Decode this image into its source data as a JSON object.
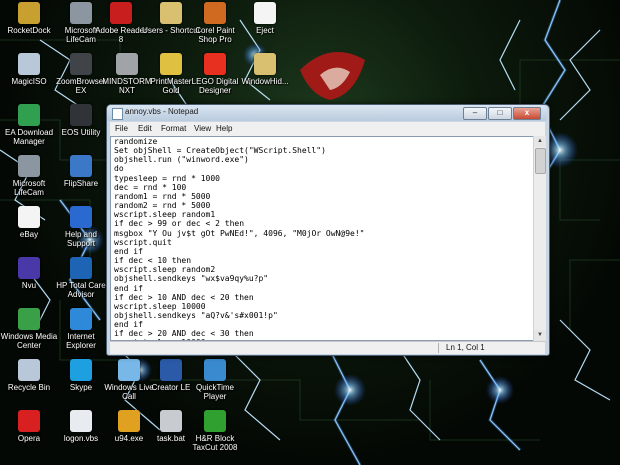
{
  "desktop": {
    "icons": [
      {
        "label": "RocketDock",
        "icon": "rocketdock-icon",
        "color": "#c8a030"
      },
      {
        "label": "Microsoft LifeCam",
        "icon": "webcam-icon",
        "color": "#8c96a0"
      },
      {
        "label": "Adobe Reader 8",
        "icon": "adobe-reader-icon",
        "color": "#c81e1e"
      },
      {
        "label": "Users - Shortcut",
        "icon": "folder-icon",
        "color": "#d8c070"
      },
      {
        "label": "Corel Paint Shop Pro",
        "icon": "corel-icon",
        "color": "#d06a20"
      },
      {
        "label": "Eject",
        "icon": "document-icon",
        "color": "#f4f4f4"
      },
      {
        "label": "MagicISO",
        "icon": "disc-icon",
        "color": "#b8c8d8"
      },
      {
        "label": "ZoomBrowser EX",
        "icon": "camera-icon",
        "color": "#404448"
      },
      {
        "label": "MINDSTORM NXT",
        "icon": "lego-icon",
        "color": "#a0a4a8"
      },
      {
        "label": "PrintMaster Gold",
        "icon": "printmaster-icon",
        "color": "#e0c040"
      },
      {
        "label": "LEGO Digital Designer",
        "icon": "lego-brick-icon",
        "color": "#e83020"
      },
      {
        "label": "WindowHid...",
        "icon": "folder-icon",
        "color": "#d8c070"
      },
      {
        "label": "EA Download Manager",
        "icon": "ea-icon",
        "color": "#30a050"
      },
      {
        "label": "EOS Utility",
        "icon": "camera-icon",
        "color": "#303438"
      },
      {
        "label": "Microsoft LifeCam",
        "icon": "webcam-icon",
        "color": "#8c96a0"
      },
      {
        "label": "FlipShare",
        "icon": "flipshare-icon",
        "color": "#3c78c8"
      },
      {
        "label": "eBay",
        "icon": "ebay-icon",
        "color": "#f4f4f4"
      },
      {
        "label": "Help and Support",
        "icon": "help-icon",
        "color": "#2a6ad0"
      },
      {
        "label": "Nvu",
        "icon": "nvu-icon",
        "color": "#4838a8"
      },
      {
        "label": "HP Total Care Advisor",
        "icon": "hp-icon",
        "color": "#1e64b4"
      },
      {
        "label": "Windows Media Center",
        "icon": "media-center-icon",
        "color": "#3aa048"
      },
      {
        "label": "Internet Explorer",
        "icon": "ie-icon",
        "color": "#2e8ad8"
      },
      {
        "label": "Recycle Bin",
        "icon": "recycle-bin-icon",
        "color": "#b8c8d8"
      },
      {
        "label": "Skype",
        "icon": "skype-icon",
        "color": "#1ea0e0"
      },
      {
        "label": "Windows Live Call",
        "icon": "windows-live-icon",
        "color": "#78b8e8"
      },
      {
        "label": "Creator LE",
        "icon": "creator-icon",
        "color": "#2a5aa8"
      },
      {
        "label": "QuickTime Player",
        "icon": "quicktime-icon",
        "color": "#3a8ad0"
      },
      {
        "label": "Opera",
        "icon": "opera-icon",
        "color": "#d82020"
      },
      {
        "label": "logon.vbs",
        "icon": "script-icon",
        "color": "#e8ecf0"
      },
      {
        "label": "u94.exe",
        "icon": "winamp-icon",
        "color": "#e0a020"
      },
      {
        "label": "task.bat",
        "icon": "batch-icon",
        "color": "#c8ccd0"
      },
      {
        "label": "H&R Block TaxCut 2008",
        "icon": "hrblock-icon",
        "color": "#30a030"
      }
    ]
  },
  "notepad": {
    "title": "annoy.vbs - Notepad",
    "buttons": {
      "minimize": "–",
      "maximize": "□",
      "close": "x"
    },
    "menu": [
      "File",
      "Edit",
      "Format",
      "View",
      "Help"
    ],
    "content": "randomize\nSet objShell = CreateObject(\"WScript.Shell\")\nobjshell.run (\"winword.exe\")\ndo\ntypesleep = rnd * 1000\ndec = rnd * 100\nrandom1 = rnd * 5000\nrandom2 = rnd * 5000\nwscript.sleep random1\nif dec > 99 or dec < 2 then\nmsgbox \"Y Ou jv$t gOt PwNEd!\", 4096, \"M0jOr OwN@9e!\"\nwscript.quit\nend if\nif dec < 10 then\nwscript.sleep random2\nobjshell.sendkeys \"wx$va9qy%u?p\"\nend if\nif dec > 10 AND dec < 20 then\nwscript.sleep 10000\nobjshell.sendkeys \"aQ?v&'s#x001!p\"\nend if\nif dec > 20 AND dec < 30 then\nwscript.sleep 10000\nobjshell.sendkeys \"oPbtO&je9o<\\\"\"",
    "status": "Ln 1, Col 1"
  }
}
